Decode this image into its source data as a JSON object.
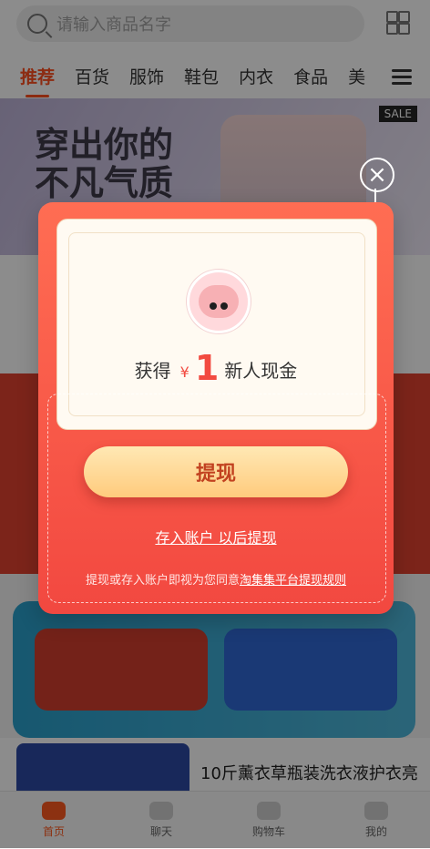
{
  "search": {
    "placeholder": "请输入商品名字"
  },
  "tabs": [
    "推荐",
    "百货",
    "服饰",
    "鞋包",
    "内衣",
    "食品",
    "美"
  ],
  "banner": {
    "line1": "穿出你的",
    "line2": "不凡气质",
    "sale": "SALE"
  },
  "product": {
    "name": "10斤薰衣草瓶装洗衣液护衣亮"
  },
  "bottom_nav": [
    "首页",
    "聊天",
    "购物车",
    "我的"
  ],
  "popup": {
    "reward_prefix": "获得",
    "currency": "¥",
    "amount": "1",
    "reward_suffix": "新人现金",
    "withdraw_button": "提现",
    "save_link": "存入账户 以后提现",
    "agree_prefix": "提现或存入账户即视为您同意",
    "agree_rule": "淘集集平台提现规则"
  },
  "colors": {
    "accent": "#ff4f1f",
    "popup_red": "#f24a40",
    "button_gold": "#ffcb7d"
  }
}
